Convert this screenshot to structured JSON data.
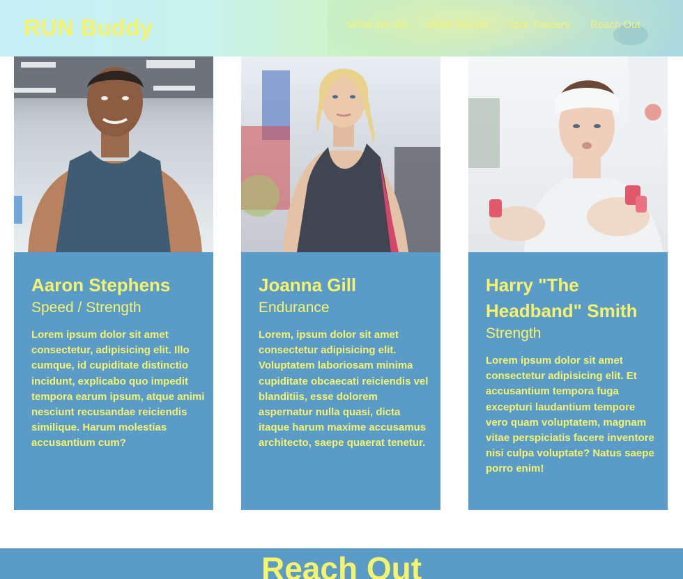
{
  "header": {
    "logo": "RUN Buddy",
    "nav": [
      {
        "label": "What We Do"
      },
      {
        "label": "What You Do"
      },
      {
        "label": "Your Trainers"
      },
      {
        "label": "Reach Out"
      }
    ]
  },
  "trainers": [
    {
      "name": "Aaron Stephens",
      "role": "Speed / Strength",
      "bio": "Lorem ipsum dolor sit amet consectetur, adipisicing elit. Illo cumque, id cupiditate distinctio incidunt, explicabo quo impedit tempora earum ipsum, atque animi nesciunt recusandae reiciendis similique. Harum molestias accusantium cum?"
    },
    {
      "name": "Joanna Gill",
      "role": "Endurance",
      "bio": "Lorem, ipsum dolor sit amet consectetur adipisicing elit. Voluptatem laboriosam minima cupiditate obcaecati reiciendis vel blanditiis, esse dolorem aspernatur nulla quasi, dicta itaque harum maxime accusamus architecto, saepe quaerat tenetur."
    },
    {
      "name": "Harry \"The Headband\" Smith",
      "role": "Strength",
      "bio": "Lorem ipsum dolor sit amet consectetur adipisicing elit. Et accusantium tempora fuga excepturi laudantium tempore vero quam voluptatem, magnam vitae perspiciatis facere inventore nisi culpa voluptate? Natus saepe porro enim!"
    }
  ],
  "reach_out": {
    "title": "Reach Out"
  },
  "colors": {
    "accent_yellow": "#f6f46a",
    "card_blue": "#5b9bc9"
  }
}
